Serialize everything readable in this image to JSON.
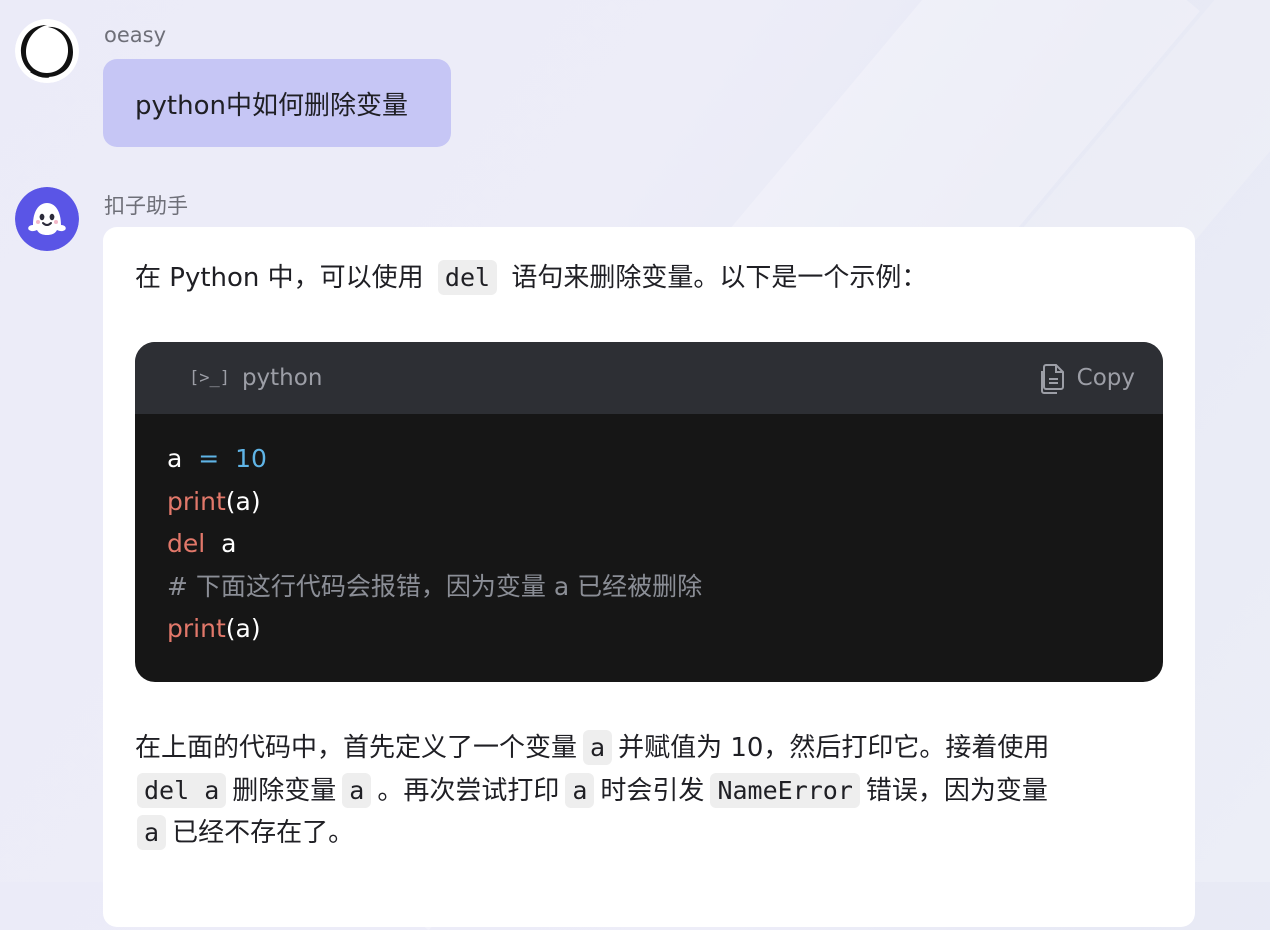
{
  "user": {
    "name": "oeasy",
    "message": "python中如何删除变量"
  },
  "bot": {
    "name": "扣子助手",
    "p1": {
      "before": "在 Python 中，可以使用",
      "code": "del",
      "after": "语句来删除变量。以下是一个示例："
    },
    "code_block": {
      "language": "python",
      "copy_label": "Copy",
      "terminal_glyph": "[>_]",
      "lines": {
        "l1_var": "a",
        "l1_op": "=",
        "l1_num": "10",
        "l2_fn": "print",
        "l2_args": "(a)",
        "l3_kw": "del",
        "l3_var": "a",
        "l4_comment": "# 下面这行代码会报错，因为变量 a 已经被删除",
        "l5_fn": "print",
        "l5_args": "(a)"
      }
    },
    "p2": {
      "t1": "在上面的代码中，首先定义了一个变量",
      "c1": "a",
      "t2": "并赋值为 10，然后打印它。接着使用",
      "c2": "del a",
      "t3": "删除变量",
      "c3": "a",
      "t4": "。再次尝试打印",
      "c4": "a",
      "t5": "时会引发",
      "c5": "NameError",
      "t6": "错误，因为变量",
      "c6": "a",
      "t7": "已经不存在了。"
    }
  },
  "colors": {
    "user_bubble": "#c6c6f5",
    "bot_avatar": "#5a55e6",
    "code_bg": "#161616",
    "code_header_bg": "#2d2f34",
    "keyword": "#e2786a",
    "number": "#5fb4e6"
  }
}
